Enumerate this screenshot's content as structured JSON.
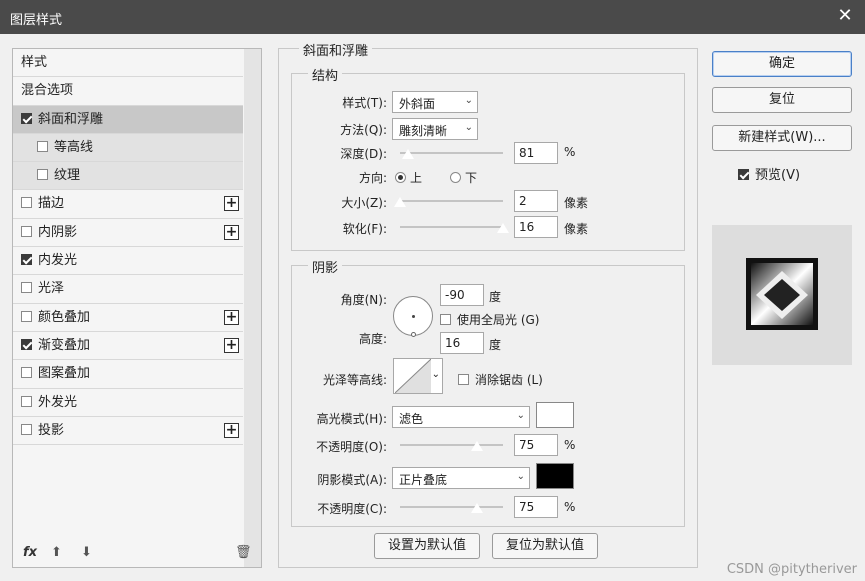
{
  "window": {
    "title": "图层样式",
    "close": "✕"
  },
  "sidebar": {
    "items": [
      {
        "label": "样式",
        "checkbox": null,
        "plus": false,
        "sub": false,
        "selected": false
      },
      {
        "label": "混合选项",
        "checkbox": null,
        "plus": false,
        "sub": false,
        "selected": false
      },
      {
        "label": "斜面和浮雕",
        "checkbox": true,
        "plus": false,
        "sub": false,
        "selected": true
      },
      {
        "label": "等高线",
        "checkbox": false,
        "plus": false,
        "sub": true,
        "selected": false
      },
      {
        "label": "纹理",
        "checkbox": false,
        "plus": false,
        "sub": true,
        "selected": false
      },
      {
        "label": "描边",
        "checkbox": false,
        "plus": true,
        "sub": false,
        "selected": false
      },
      {
        "label": "内阴影",
        "checkbox": false,
        "plus": true,
        "sub": false,
        "selected": false
      },
      {
        "label": "内发光",
        "checkbox": true,
        "plus": false,
        "sub": false,
        "selected": false
      },
      {
        "label": "光泽",
        "checkbox": false,
        "plus": false,
        "sub": false,
        "selected": false
      },
      {
        "label": "颜色叠加",
        "checkbox": false,
        "plus": true,
        "sub": false,
        "selected": false
      },
      {
        "label": "渐变叠加",
        "checkbox": true,
        "plus": true,
        "sub": false,
        "selected": false
      },
      {
        "label": "图案叠加",
        "checkbox": false,
        "plus": false,
        "sub": false,
        "selected": false
      },
      {
        "label": "外发光",
        "checkbox": false,
        "plus": false,
        "sub": false,
        "selected": false
      },
      {
        "label": "投影",
        "checkbox": false,
        "plus": true,
        "sub": false,
        "selected": false
      }
    ],
    "tools": {
      "fx": "fx",
      "up": "⬆",
      "down": "⬇",
      "trash": "🗑"
    }
  },
  "bevel": {
    "section_title": "斜面和浮雕",
    "structure": {
      "title": "结构",
      "style_label": "样式(T):",
      "style_value": "外斜面",
      "technique_label": "方法(Q):",
      "technique_value": "雕刻清晰",
      "depth_label": "深度(D):",
      "depth_value": "81",
      "depth_unit": "%",
      "depth_level": 0.08,
      "direction_label": "方向:",
      "direction_up": "上",
      "direction_down": "下",
      "size_label": "大小(Z):",
      "size_value": "2",
      "size_unit": "像素",
      "size_level": 0.0,
      "soften_label": "软化(F):",
      "soften_value": "16",
      "soften_unit": "像素",
      "soften_level": 1.0
    },
    "shading": {
      "title": "阴影",
      "angle_label": "角度(N):",
      "angle_value": "-90",
      "angle_unit": "度",
      "global_light_label": "使用全局光 (G)",
      "altitude_label": "高度:",
      "altitude_value": "16",
      "altitude_unit": "度",
      "gloss_label": "光泽等高线:",
      "antialias_label": "消除锯齿 (L)",
      "highlight_mode_label": "高光模式(H):",
      "highlight_mode_value": "滤色",
      "highlight_color": "#ffffff",
      "highlight_opacity_label": "不透明度(O):",
      "highlight_opacity_value": "75",
      "highlight_opacity_unit": "%",
      "highlight_opacity_level": 0.75,
      "shadow_mode_label": "阴影模式(A):",
      "shadow_mode_value": "正片叠底",
      "shadow_color": "#000000",
      "shadow_opacity_label": "不透明度(C):",
      "shadow_opacity_value": "75",
      "shadow_opacity_unit": "%",
      "shadow_opacity_level": 0.75
    },
    "buttons": {
      "set_default": "设置为默认值",
      "reset_default": "复位为默认值"
    }
  },
  "right": {
    "ok": "确定",
    "reset": "复位",
    "new_style": "新建样式(W)...",
    "preview_label": "预览(V)"
  },
  "watermark": "CSDN @pitytheriver"
}
